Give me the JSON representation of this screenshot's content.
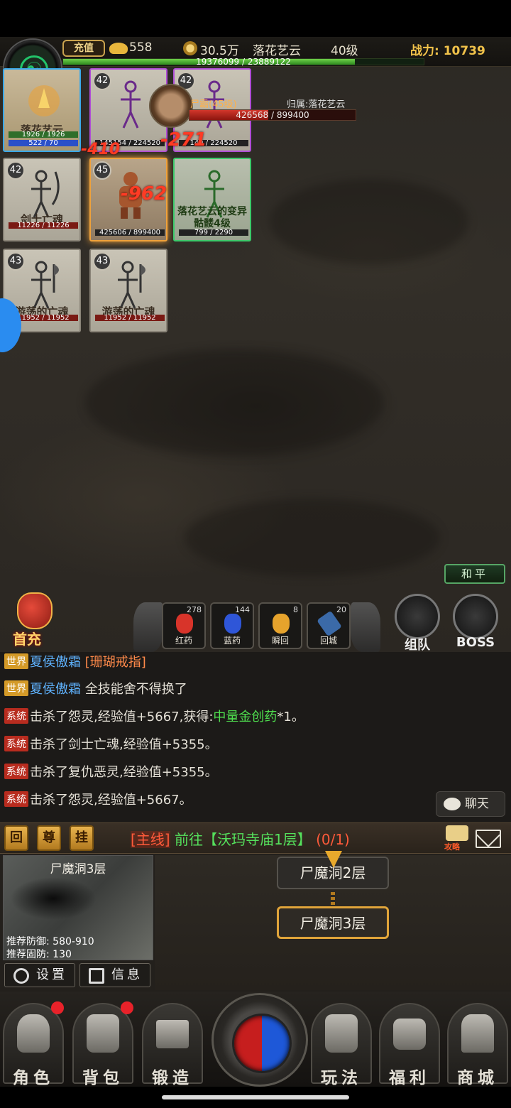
{
  "topbar": {
    "recharge": "充值",
    "gold": "558",
    "coins": "30.5万",
    "player_name": "落花艺云",
    "level": "40级",
    "power_label": "战力: 10739",
    "exp_text": "19376099 / 23889122",
    "exp_fraction": 0.81
  },
  "units": [
    {
      "name": "落花艺云",
      "hp": "1926 / 1926",
      "mp": "522 / 70"
    },
    {
      "level": "42",
      "hp": "145154 / 224520"
    },
    {
      "level": "42",
      "hp": "149 / 224520"
    },
    {
      "level": "42",
      "name": "剑士亡魂",
      "hp": "11226 / 11226"
    },
    {
      "level": "45",
      "hp": "425606 / 899400"
    },
    {
      "name": "落花艺云的变异骷髅4级",
      "hp": "799 / 2290"
    },
    {
      "level": "43",
      "name": "游荡的亡魂",
      "hp": "11952 / 11952"
    },
    {
      "level": "43",
      "name": "游荡的亡魂",
      "hp": "11952 / 11952"
    }
  ],
  "damage": [
    "-410",
    "-271",
    "-962"
  ],
  "boss": {
    "name": "尸霸(45级)",
    "owner": "归属:落花艺云",
    "hp_text": "426568 / 899400",
    "hp_fraction": 0.474
  },
  "mode": "和平",
  "first_charge": "首充",
  "potions": [
    {
      "label": "红药",
      "count": "278",
      "color": "#d8342a"
    },
    {
      "label": "蓝药",
      "count": "144",
      "color": "#2f56d8"
    },
    {
      "label": "瞬回",
      "count": "8",
      "color": "#e6a32c"
    },
    {
      "label": "回城",
      "count": "20",
      "color": "#3b6aa8"
    }
  ],
  "team_label": "组队",
  "boss_label": "BOSS",
  "chat": [
    {
      "tag": "世界",
      "name": "夏侯傲霜",
      "text": "[珊瑚戒指]"
    },
    {
      "tag": "世界",
      "name": "夏侯傲霜",
      "text": "全技能舍不得换了"
    },
    {
      "tag": "系统",
      "text": "击杀了怨灵,经验值+5667,获得:",
      "item": "中量金创药",
      "suffix": "*1。"
    },
    {
      "tag": "系统",
      "text": "击杀了剑士亡魂,经验值+5355。"
    },
    {
      "tag": "系统",
      "text": "击杀了复仇恶灵,经验值+5355。"
    },
    {
      "tag": "系统",
      "text": "击杀了怨灵,经验值+5667。"
    }
  ],
  "chat_button": "聊天",
  "quest": {
    "btn1": "回",
    "btn2": "尊",
    "btn3": "挂",
    "tag": "[主线]",
    "text": "前往【沃玛寺庙1层】",
    "progress": "(0/1)",
    "guide": "攻略"
  },
  "minimap": {
    "title": "尸魔洞3层",
    "defense": "推荐防御: 580-910",
    "fixed_defense": "推荐固防: 130"
  },
  "settings_label": "设置",
  "info_label": "信息",
  "route": {
    "prev": "尸魔洞2层",
    "current": "尸魔洞3层"
  },
  "nav": [
    {
      "label": "角色",
      "dot": true
    },
    {
      "label": "背包",
      "dot": true
    },
    {
      "label": "锻造",
      "dot": false
    },
    {
      "label": "玩法",
      "dot": false
    },
    {
      "label": "福利",
      "dot": false
    },
    {
      "label": "商城",
      "dot": false
    }
  ]
}
